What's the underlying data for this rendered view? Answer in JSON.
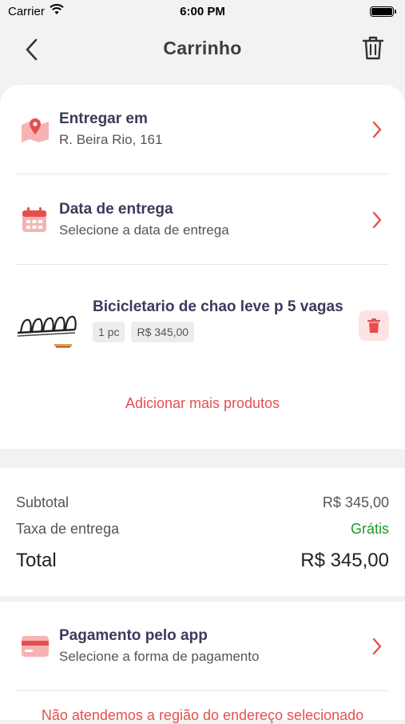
{
  "status_bar": {
    "carrier": "Carrier",
    "time": "6:00 PM"
  },
  "nav": {
    "title": "Carrinho"
  },
  "delivery": {
    "title": "Entregar em",
    "address": "R. Beira Rio, 161"
  },
  "date": {
    "title": "Data de entrega",
    "subtitle": "Selecione a data de entrega"
  },
  "product": {
    "name": "Bicicletario de chao leve p 5 vagas",
    "quantity": "1 pc",
    "price": "R$ 345,00"
  },
  "add_more": "Adicionar mais produtos",
  "summary": {
    "subtotal_label": "Subtotal",
    "subtotal_value": "R$ 345,00",
    "fee_label": "Taxa de entrega",
    "fee_value": "Grátis",
    "total_label": "Total",
    "total_value": "R$ 345,00"
  },
  "payment": {
    "title": "Pagamento pelo app",
    "subtitle": "Selecione a forma de pagamento"
  },
  "warning": "Não atendemos a região do endereço selecionado",
  "colors": {
    "accent": "#e84e4e",
    "title_text": "#3b3a5c",
    "free_green": "#1a9a2a",
    "danger_bg": "#fde3e3"
  },
  "icons": [
    "back-chevron-icon",
    "trash-icon",
    "map-pin-icon",
    "calendar-icon",
    "chevron-right-icon",
    "credit-card-icon",
    "wifi-icon",
    "battery-icon"
  ]
}
